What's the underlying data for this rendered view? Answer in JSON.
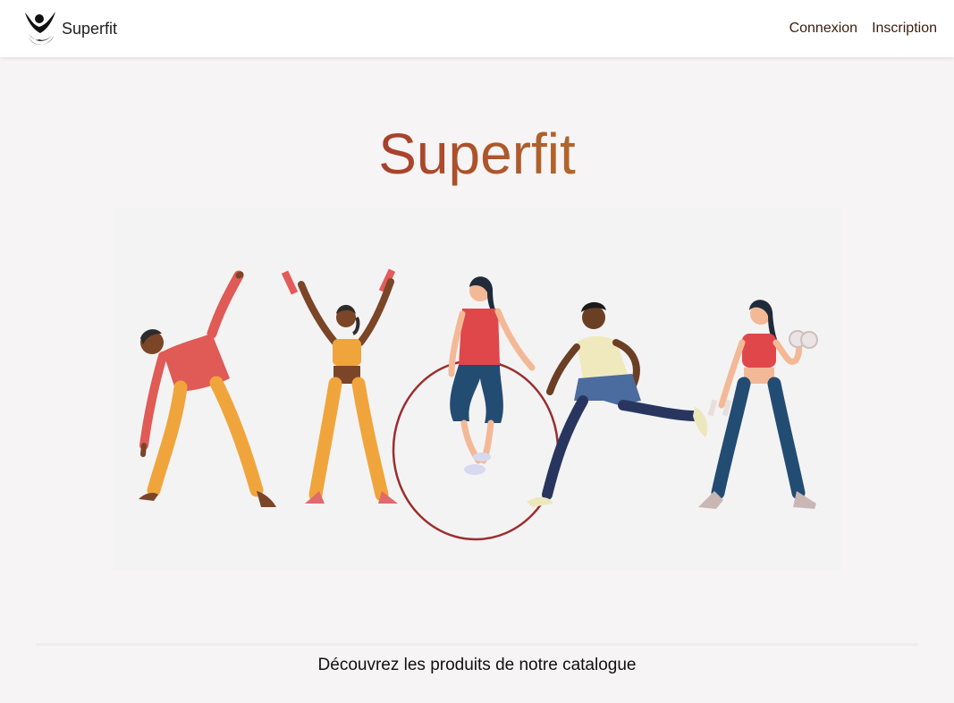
{
  "navbar": {
    "brand_name": "Superfit",
    "brand_logo_icon": "superfit-logo-icon",
    "links": [
      {
        "label": "Connexion"
      },
      {
        "label": "Inscription"
      }
    ]
  },
  "hero": {
    "title": "Superfit",
    "title_gradient": [
      "#a63a32",
      "#b9822c"
    ],
    "illustration_icon": "fitness-people-illustration",
    "catalog_text": "Découvrez les produits de notre catalogue"
  },
  "colors": {
    "background": "#f6f4f4",
    "navbar": "#ffffff",
    "nav_link": "#3b1c10"
  }
}
